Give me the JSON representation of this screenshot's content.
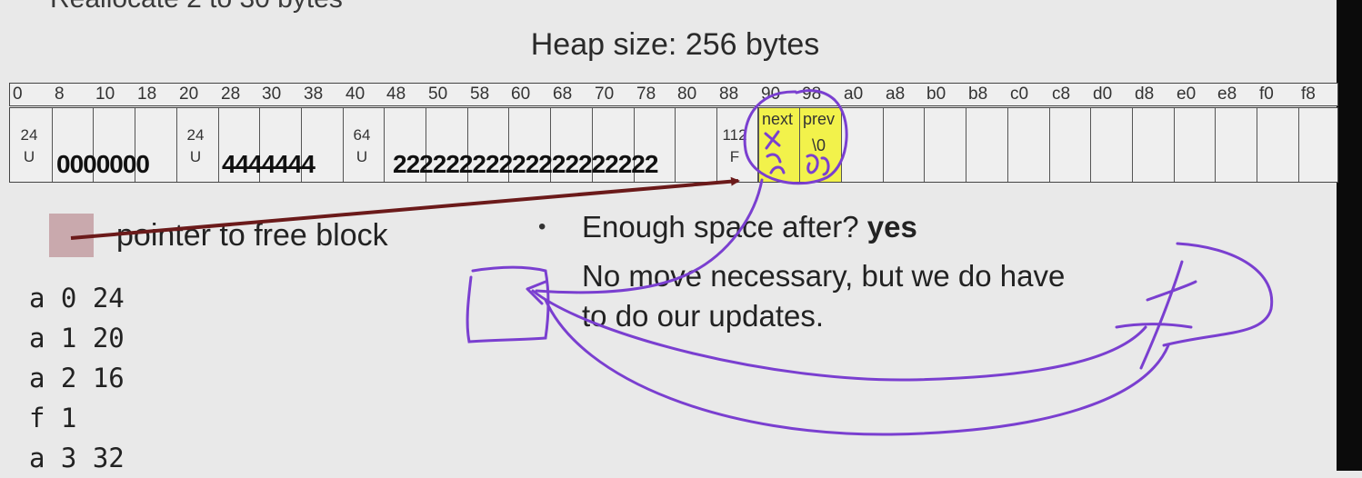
{
  "slide": {
    "title_partial": "Reallocate 2 to 30 bytes"
  },
  "heap": {
    "title": "Heap size: 256 bytes",
    "addresses": [
      "0",
      "8",
      "10",
      "18",
      "20",
      "28",
      "30",
      "38",
      "40",
      "48",
      "50",
      "58",
      "60",
      "68",
      "70",
      "78",
      "80",
      "88",
      "90",
      "98",
      "a0",
      "a8",
      "b0",
      "b8",
      "c0",
      "c8",
      "d0",
      "d8",
      "e0",
      "e8",
      "f0",
      "f8"
    ],
    "blocks": [
      {
        "size": "24",
        "status": "U",
        "payload": "0000000"
      },
      {
        "size": "24",
        "status": "U",
        "payload": "4444444"
      },
      {
        "size": "64",
        "status": "U",
        "payload": "22222222222222222222"
      },
      {
        "size": "112",
        "status": "F",
        "next_label": "next",
        "prev_label": "prev",
        "prev_value": "\\0"
      }
    ]
  },
  "legend": {
    "label": "pointer to free block",
    "color": "#c9a9ad"
  },
  "commands": [
    "a 0 24",
    "a 1 20",
    "a 2 16",
    "f 1",
    "a 3 32"
  ],
  "notes": {
    "bullet": "•",
    "question": "Enough space after?",
    "answer": "yes",
    "line1": "No move necessary, but we do have",
    "line2": "to do our updates."
  },
  "colors": {
    "free_block_fill": "#f2f24b",
    "arrow": "#6b1a1a",
    "annotation_ink": "#7a3fd0"
  }
}
